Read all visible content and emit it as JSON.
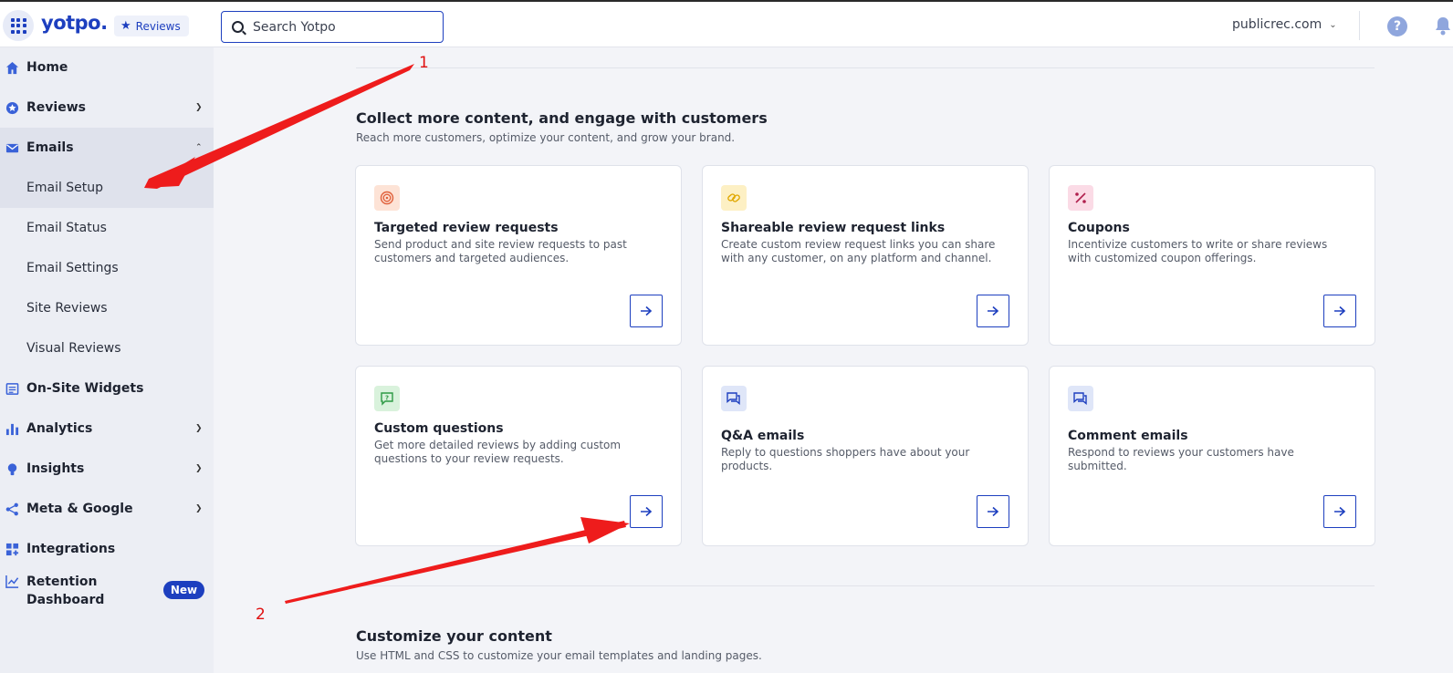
{
  "app": {
    "logo": "yotpo.",
    "product": "Reviews",
    "store": "publicrec.com"
  },
  "search": {
    "placeholder": "Search Yotpo"
  },
  "sidebar": {
    "items": [
      {
        "label": "Home",
        "icon": "home-icon"
      },
      {
        "label": "Reviews",
        "icon": "star-badge-icon"
      },
      {
        "label": "Emails",
        "icon": "mail-icon"
      },
      {
        "label": "On-Site Widgets",
        "icon": "widget-icon"
      },
      {
        "label": "Analytics",
        "icon": "bar-chart-icon"
      },
      {
        "label": "Insights",
        "icon": "lightbulb-icon"
      },
      {
        "label": "Meta & Google",
        "icon": "share-icon"
      },
      {
        "label": "Integrations",
        "icon": "integrations-icon"
      },
      {
        "label": "Retention Dashboard",
        "icon": "trend-icon",
        "badge": "New"
      }
    ],
    "email_sub": [
      "Email Setup",
      "Email Status",
      "Email Settings",
      "Site Reviews",
      "Visual Reviews"
    ]
  },
  "section1": {
    "title": "Collect more content, and engage with customers",
    "subtitle": "Reach more customers, optimize your content, and grow your brand."
  },
  "cards": [
    {
      "title": "Targeted review requests",
      "desc": "Send product and site review requests to past customers and targeted audiences.",
      "icon": "target-icon"
    },
    {
      "title": "Shareable review request links",
      "desc": "Create custom review request links you can share with any customer, on any platform and channel.",
      "icon": "link-icon"
    },
    {
      "title": "Coupons",
      "desc": "Incentivize customers to write or share reviews with customized coupon offerings.",
      "icon": "percent-icon"
    },
    {
      "title": "Custom questions",
      "desc": "Get more detailed reviews by adding custom questions to your review requests.",
      "icon": "question-bubble-icon"
    },
    {
      "title": "Q&A emails",
      "desc": "Reply to questions shoppers have about your products.",
      "icon": "chat-bubbles-icon"
    },
    {
      "title": "Comment emails",
      "desc": "Respond to reviews your customers have submitted.",
      "icon": "chat-bubbles-icon"
    }
  ],
  "section2": {
    "title": "Customize your content",
    "subtitle": "Use HTML and CSS to customize your email templates and landing pages."
  },
  "annotations": [
    "1",
    "2"
  ],
  "colors": {
    "brand": "#1d3fbf",
    "annotation": "#e01010"
  }
}
